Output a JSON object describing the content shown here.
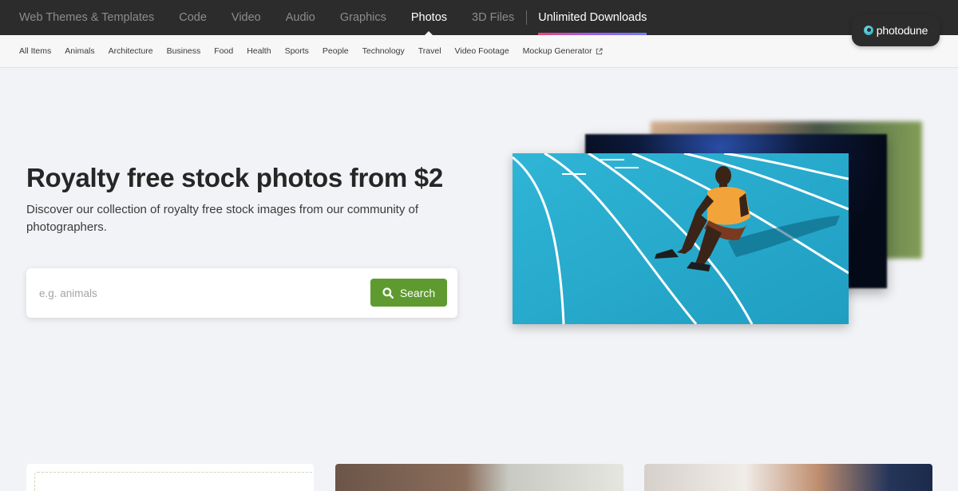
{
  "topnav": {
    "tabs": [
      {
        "label": "Web Themes & Templates"
      },
      {
        "label": "Code"
      },
      {
        "label": "Video"
      },
      {
        "label": "Audio"
      },
      {
        "label": "Graphics"
      },
      {
        "label": "Photos",
        "active": true
      },
      {
        "label": "3D Files"
      }
    ],
    "unlimited_label": "Unlimited Downloads",
    "brand": "photodune"
  },
  "subnav": {
    "categories": [
      "All Items",
      "Animals",
      "Architecture",
      "Business",
      "Food",
      "Health",
      "Sports",
      "People",
      "Technology",
      "Travel",
      "Video Footage"
    ],
    "mockup_label": "Mockup Generator"
  },
  "hero": {
    "title": "Royalty free stock photos from $2",
    "subtitle": "Discover our collection of royalty free stock images from our community of photographers.",
    "search_placeholder": "e.g. animals",
    "search_label": "Search"
  },
  "colors": {
    "topbar": "#2c2c2c",
    "search_button": "#5f9a30",
    "track": "#2aa8cc"
  },
  "icons": [
    "search-icon",
    "external-link-icon",
    "photodune-logo-icon"
  ]
}
